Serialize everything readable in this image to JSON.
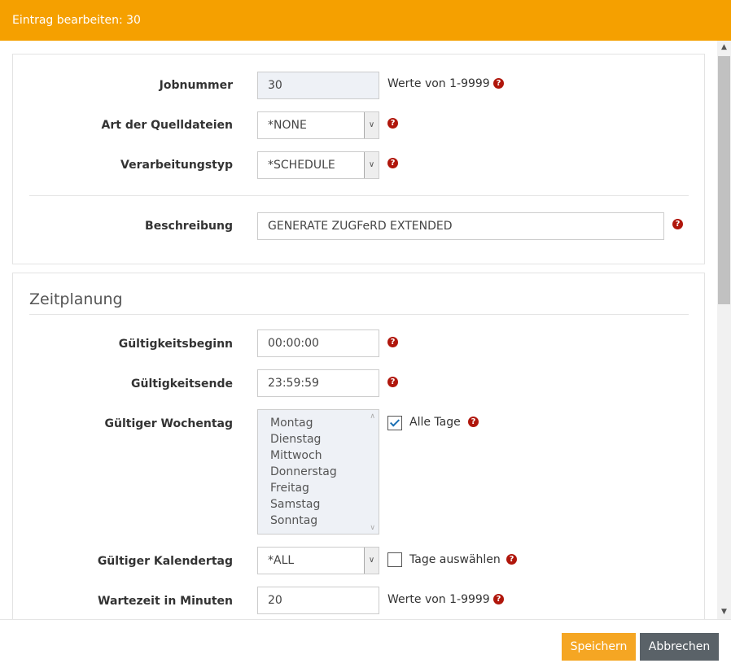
{
  "window": {
    "title": "Eintrag bearbeiten: 30"
  },
  "general": {
    "jobnummer": {
      "label": "Jobnummer",
      "value": "30",
      "hint": "Werte von 1-9999"
    },
    "quelldateien": {
      "label": "Art der Quelldateien",
      "value": "*NONE"
    },
    "verarbeitungstyp": {
      "label": "Verarbeitungstyp",
      "value": "*SCHEDULE"
    },
    "beschreibung": {
      "label": "Beschreibung",
      "value": "GENERATE ZUGFeRD EXTENDED"
    }
  },
  "zeitplanung": {
    "title": "Zeitplanung",
    "gueltigkeitsbeginn": {
      "label": "Gültigkeitsbeginn",
      "value": "00:00:00"
    },
    "gueltigkeitsende": {
      "label": "Gültigkeitsende",
      "value": "23:59:59"
    },
    "wochentag": {
      "label": "Gültiger Wochentag",
      "options": [
        "Montag",
        "Dienstag",
        "Mittwoch",
        "Donnerstag",
        "Freitag",
        "Samstag",
        "Sonntag"
      ],
      "alle_tage_label": "Alle Tage",
      "alle_tage_checked": true
    },
    "kalendertag": {
      "label": "Gültiger Kalendertag",
      "value": "*ALL",
      "tage_auswaehlen_label": "Tage auswählen",
      "tage_auswaehlen_checked": false
    },
    "wartezeit": {
      "label": "Wartezeit in Minuten",
      "value": "20",
      "hint": "Werte von 1-9999"
    }
  },
  "footer": {
    "save_label": "Speichern",
    "cancel_label": "Abbrechen"
  },
  "icons": {
    "help": "question-circle-icon",
    "chevron": "chevron-down-icon",
    "check": "check-icon"
  },
  "colors": {
    "header": "#f5a000",
    "save_button": "#f5a623",
    "cancel_button": "#5a6268",
    "help_icon": "#b0160b"
  }
}
